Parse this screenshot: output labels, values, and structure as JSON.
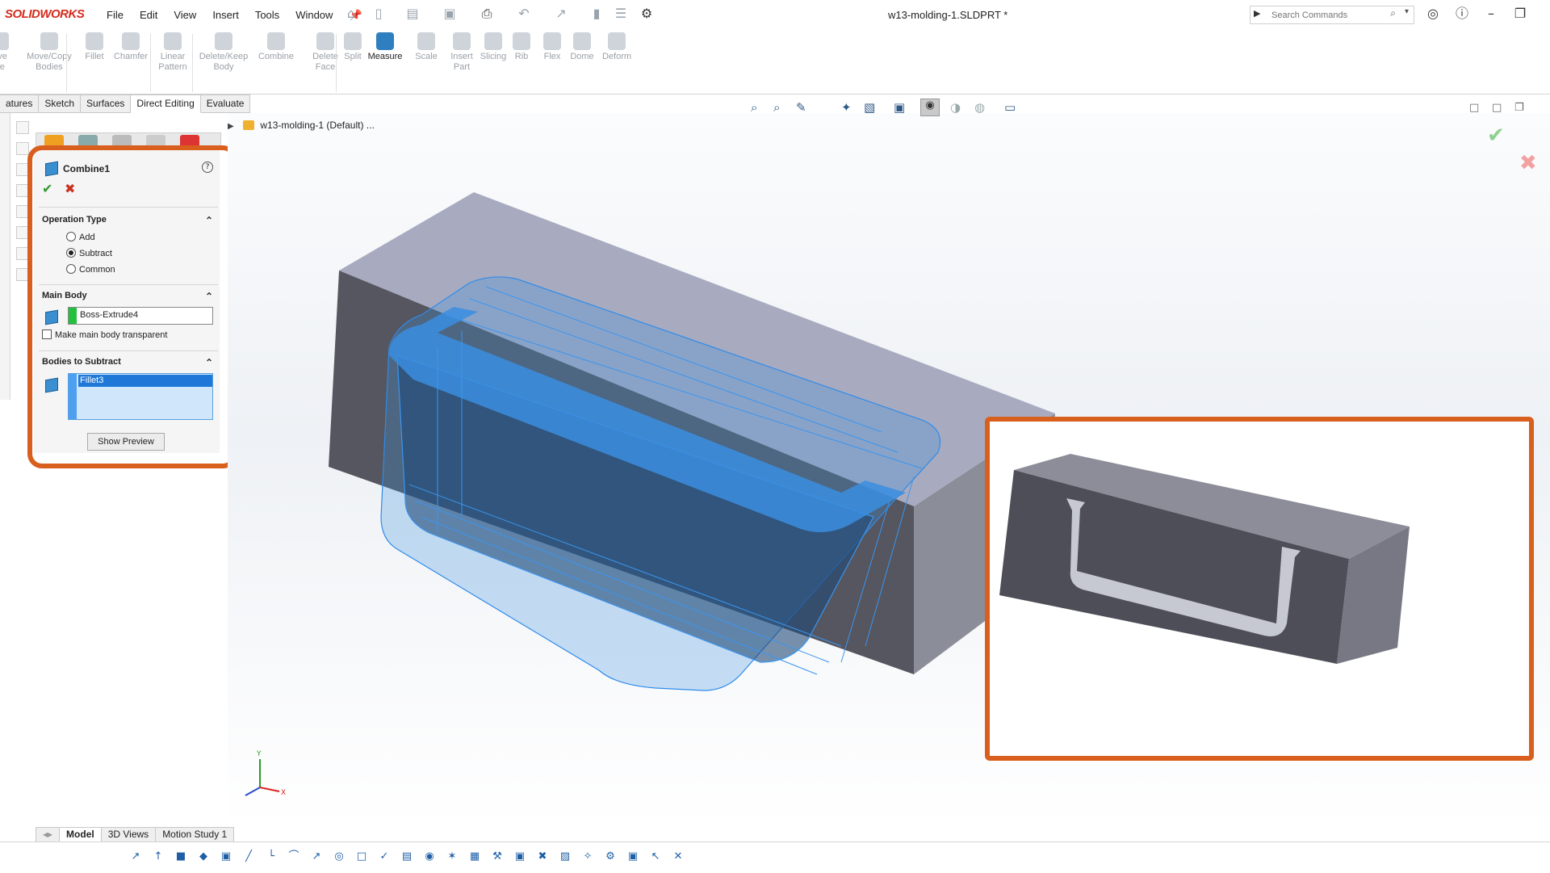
{
  "app": {
    "logo_text": "SOLIDWORKS",
    "doc_title": "w13-molding-1.SLDPRT *",
    "brand_color": "#d52b1e",
    "highlight_color": "#d95f1e"
  },
  "menu": [
    "File",
    "Edit",
    "View",
    "Insert",
    "Tools",
    "Window"
  ],
  "search": {
    "placeholder": "Search Commands"
  },
  "toolbar": {
    "tools": [
      {
        "label": "ove\nce",
        "icon": "move-face-icon"
      },
      {
        "label": "Move/Copy\nBodies",
        "icon": "move-copy-icon"
      },
      {
        "label": "Fillet",
        "icon": "fillet-icon"
      },
      {
        "label": "Chamfer",
        "icon": "chamfer-icon"
      },
      {
        "label": "Linear\nPattern",
        "icon": "linear-pattern-icon"
      },
      {
        "label": "Delete/Keep\nBody",
        "icon": "delete-keep-body-icon"
      },
      {
        "label": "Combine",
        "icon": "combine-icon"
      },
      {
        "label": "Delete\nFace",
        "icon": "delete-face-icon"
      },
      {
        "label": "Split",
        "icon": "split-icon"
      },
      {
        "label": "Measure",
        "icon": "measure-icon"
      },
      {
        "label": "Scale",
        "icon": "scale-icon"
      },
      {
        "label": "Insert\nPart",
        "icon": "insert-part-icon"
      },
      {
        "label": "Slicing",
        "icon": "slicing-icon"
      },
      {
        "label": "Rib",
        "icon": "rib-icon"
      },
      {
        "label": "Flex",
        "icon": "flex-icon"
      },
      {
        "label": "Dome",
        "icon": "dome-icon"
      },
      {
        "label": "Deform",
        "icon": "deform-icon"
      }
    ]
  },
  "cmd_tabs": [
    "atures",
    "Sketch",
    "Surfaces",
    "Direct Editing",
    "Evaluate"
  ],
  "tree": {
    "root_label": "w13-molding-1 (Default) ..."
  },
  "property_manager": {
    "title": "Combine1",
    "help": "?",
    "ok_icon": "check-icon",
    "cancel_icon": "close-icon",
    "operation_type": {
      "header": "Operation Type",
      "options": [
        "Add",
        "Subtract",
        "Common"
      ],
      "selected": "Subtract"
    },
    "main_body": {
      "header": "Main Body",
      "value": "Boss-Extrude4",
      "swatch_color": "#22c03c",
      "transparent_label": "Make main body transparent"
    },
    "bodies_to_subtract": {
      "header": "Bodies to Subtract",
      "items": [
        "Fillet3"
      ]
    },
    "preview_button": "Show Preview"
  },
  "bottom_tabs": [
    "Model",
    "3D Views",
    "Motion Study 1"
  ],
  "triad": {
    "y": "Y",
    "x": "X"
  }
}
